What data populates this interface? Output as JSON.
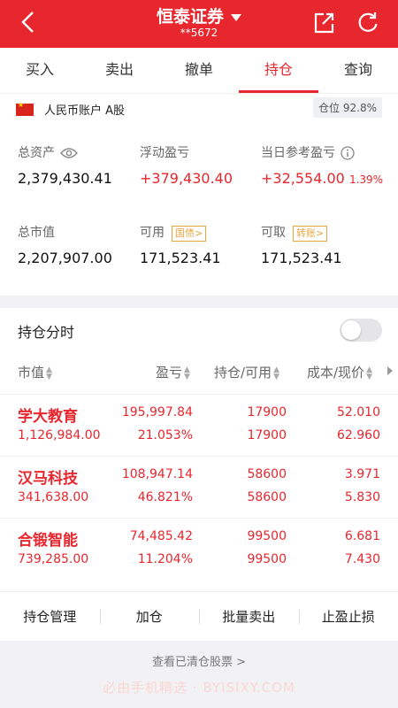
{
  "header": {
    "title": "恒泰证券",
    "account_mask": "**5672",
    "bg_color": "#e8262d"
  },
  "tabs": [
    {
      "label": "买入"
    },
    {
      "label": "卖出"
    },
    {
      "label": "撤单"
    },
    {
      "label": "持仓",
      "active": true
    },
    {
      "label": "查询"
    }
  ],
  "account": {
    "name": "人民币账户 A股",
    "position_label": "仓位",
    "position_value": "92.8%",
    "total_assets_label": "总资产",
    "total_assets": "2,379,430.41",
    "floating_pnl_label": "浮动盈亏",
    "floating_pnl": "+379,430.40",
    "day_pnl_label": "当日参考盈亏",
    "day_pnl": "+32,554.00",
    "day_pnl_pct": "1.39%",
    "market_value_label": "总市值",
    "market_value": "2,207,907.00",
    "available_label": "可用",
    "available_tag": "国债>",
    "available": "171,523.41",
    "withdrawable_label": "可取",
    "withdrawable_tag": "转账>",
    "withdrawable": "171,523.41"
  },
  "holdings": {
    "title": "持仓分时",
    "toggle_on": false,
    "columns": [
      "市值",
      "盈亏",
      "持仓/可用",
      "成本/现价"
    ],
    "rows": [
      {
        "name": "学大教育",
        "market_value": "1,126,984.00",
        "pnl": "195,997.84",
        "pnl_pct": "21.053%",
        "holding": "17900",
        "available": "17900",
        "cost": "52.010",
        "price": "62.960"
      },
      {
        "name": "汉马科技",
        "market_value": "341,638.00",
        "pnl": "108,947.14",
        "pnl_pct": "46.821%",
        "holding": "58600",
        "available": "58600",
        "cost": "3.971",
        "price": "5.830"
      },
      {
        "name": "合锻智能",
        "market_value": "739,285.00",
        "pnl": "74,485.42",
        "pnl_pct": "11.204%",
        "holding": "99500",
        "available": "99500",
        "cost": "6.681",
        "price": "7.430"
      }
    ]
  },
  "actions": [
    "持仓管理",
    "加仓",
    "批量卖出",
    "止盈止损"
  ],
  "cleared_link": "查看已清仓股票 >",
  "watermark": "必由手机精选 · BYISIXY.COM"
}
